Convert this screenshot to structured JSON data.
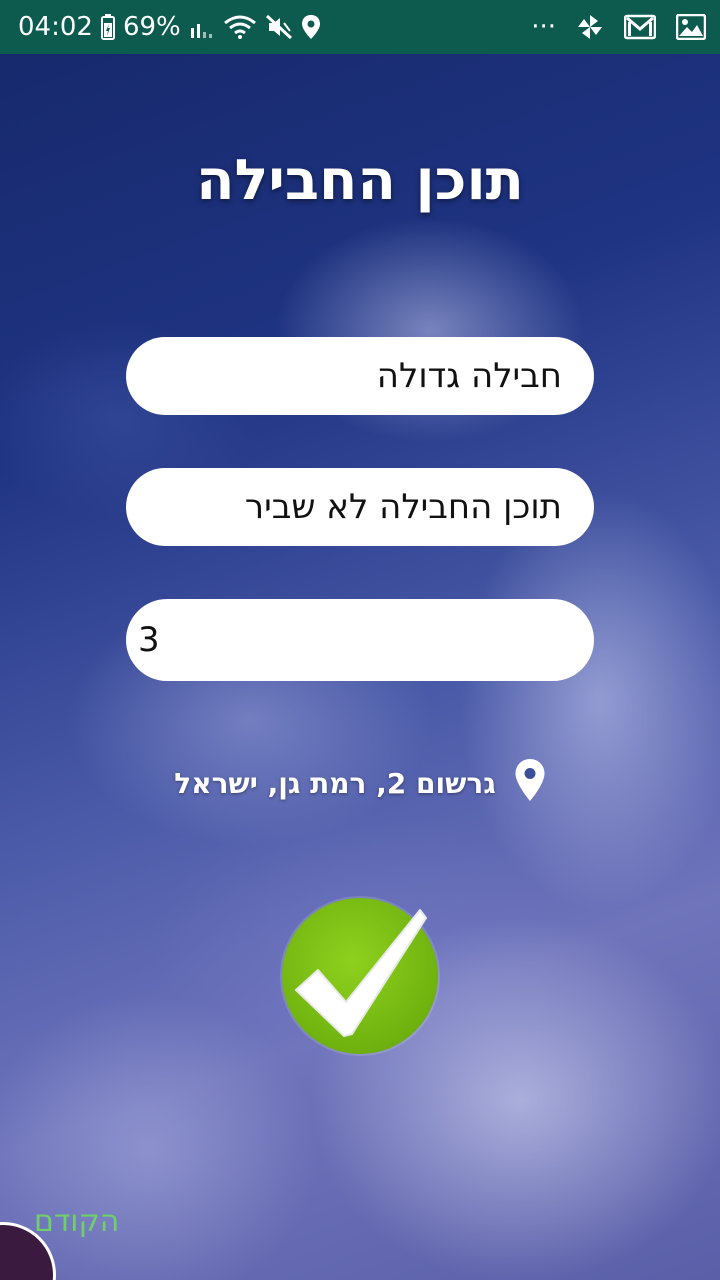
{
  "status_bar": {
    "time": "04:02",
    "battery": "69%",
    "overflow": "···",
    "icons": [
      "battery-icon",
      "signal-icon",
      "wifi-icon",
      "mute-icon",
      "location-icon",
      "pinwheel-icon",
      "gmail-icon",
      "gallery-icon"
    ]
  },
  "page": {
    "title": "תוכן החבילה"
  },
  "form": {
    "size_value": "חבילה גדולה",
    "content_value": "תוכן החבילה לא שביר",
    "quantity_value": "3"
  },
  "location": {
    "address": "גרשום 2, רמת גן, ישראל",
    "icon": "map-pin-icon"
  },
  "actions": {
    "confirm_icon": "checkmark-icon",
    "back_label": "הקודם"
  },
  "colors": {
    "status_bar": "#0d5a4f",
    "confirm_green": "#7cc116",
    "back_link": "#6fd06a"
  }
}
